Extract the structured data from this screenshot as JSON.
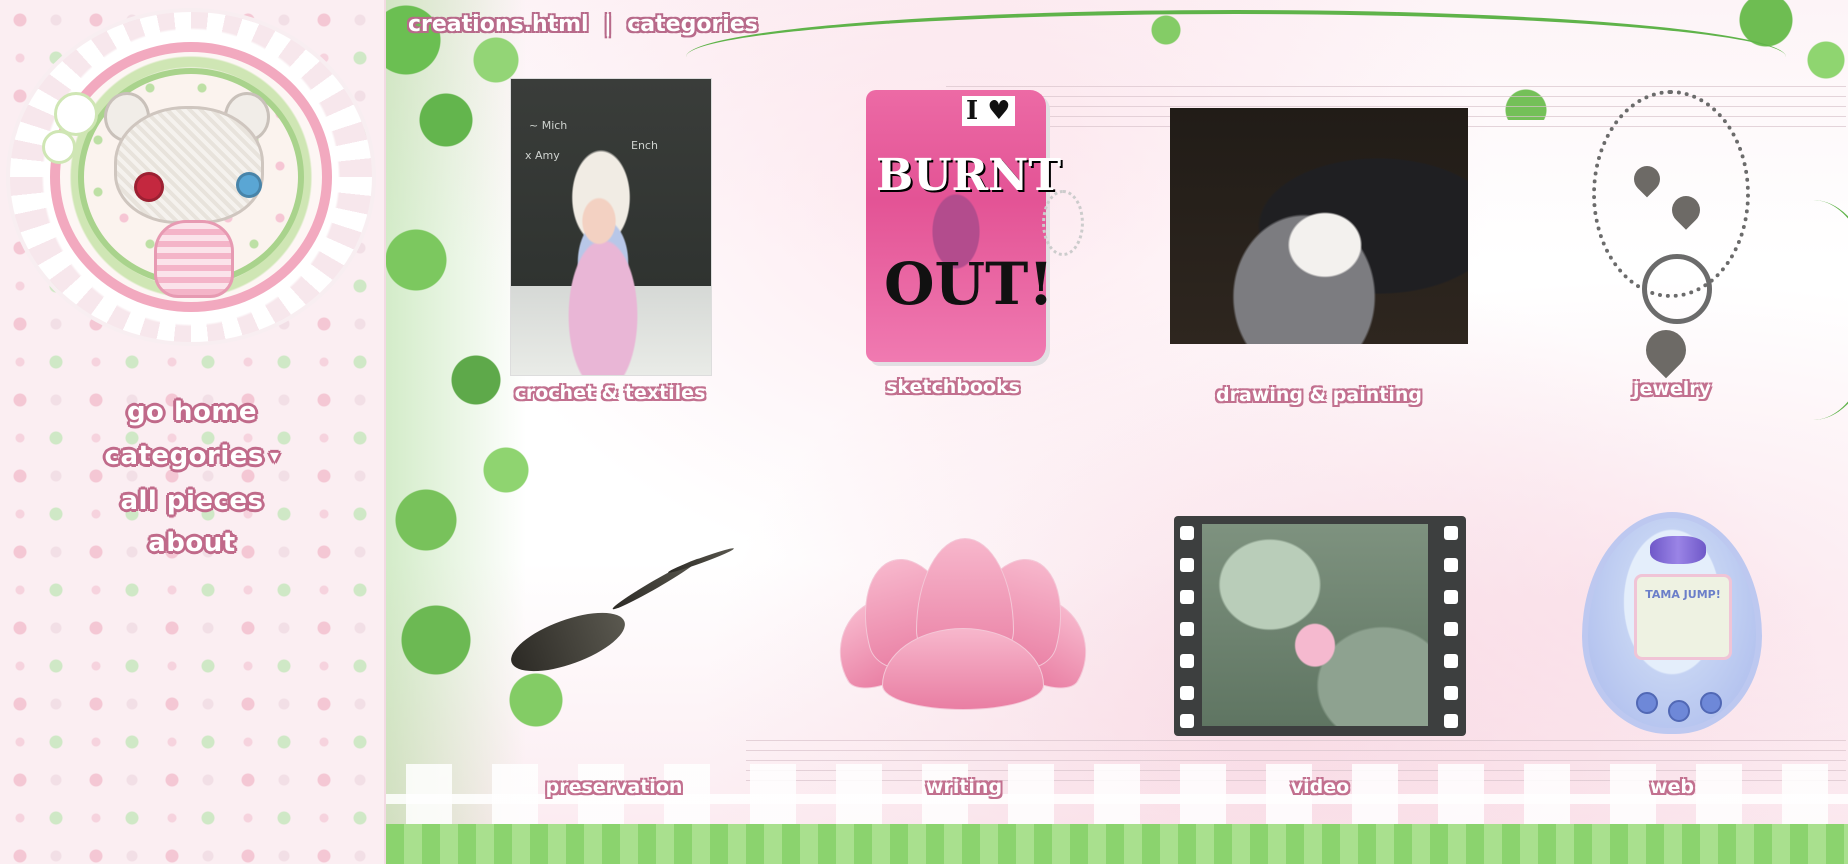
{
  "sidebar": {
    "nav": [
      {
        "label": "go home"
      },
      {
        "label": "categories",
        "caret": "▾"
      },
      {
        "label": "all pieces"
      },
      {
        "label": "about"
      }
    ]
  },
  "main": {
    "breadcrumb": "creations.html  |  categories",
    "categories": [
      {
        "label": "crochet & textiles",
        "icon": "crochet-photo"
      },
      {
        "label": "sketchbooks",
        "icon": "sketchbook-photo"
      },
      {
        "label": "drawing & painting",
        "icon": "cat-painting-photo"
      },
      {
        "label": "jewelry",
        "icon": "necklace-photo"
      },
      {
        "label": "preservation",
        "icon": "lizard-specimen-photo"
      },
      {
        "label": "writing",
        "icon": "lotus-flower-icon"
      },
      {
        "label": "video",
        "icon": "film-strip-icon"
      },
      {
        "label": "web",
        "icon": "tamagotchi-icon"
      }
    ],
    "sketchbook_cover": {
      "word1": "BURNT",
      "word2": "OUT!",
      "word3": "I ♥"
    },
    "tamagotchi_screen": "TAMA JUMP!"
  },
  "colors": {
    "outline_pink": "#c2708f",
    "sidebar_bg": "#fbeef2",
    "vine_green": "#6bbf52"
  }
}
